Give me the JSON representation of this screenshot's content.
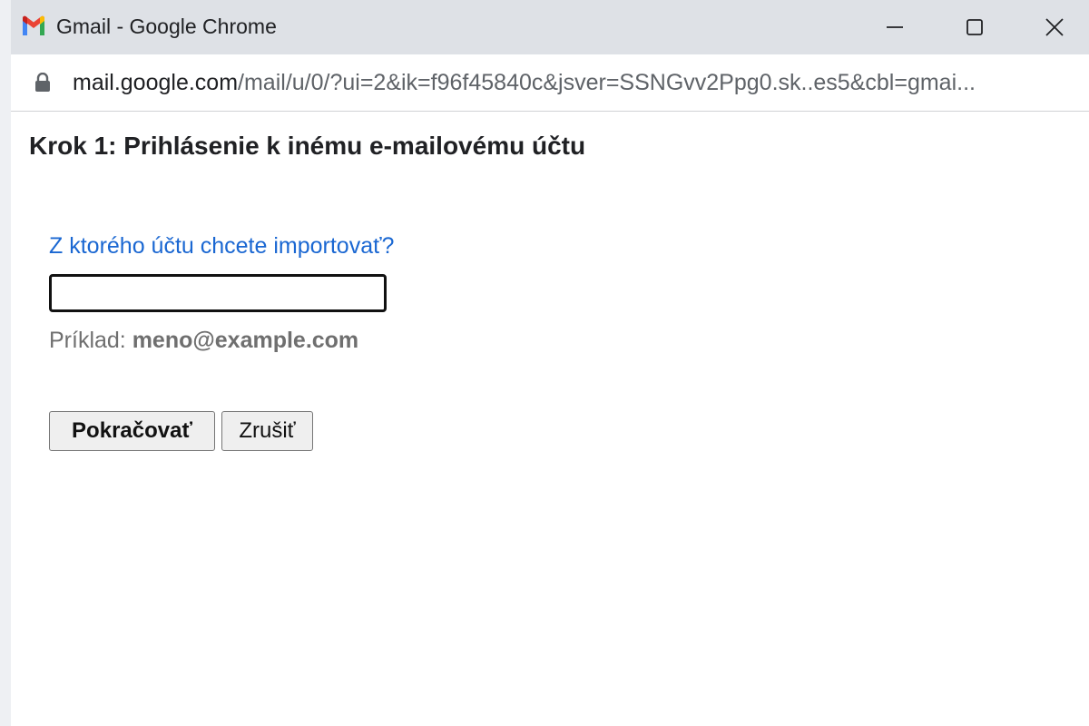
{
  "window": {
    "title": "Gmail - Google Chrome",
    "app_icon": "gmail-icon"
  },
  "addressbar": {
    "host": "mail.google.com",
    "path": "/mail/u/0/?ui=2&ik=f96f45840c&jsver=SSNGvv2Ppg0.sk..es5&cbl=gmai..."
  },
  "page": {
    "heading": "Krok 1: Prihlásenie k inému e-mailovému účtu",
    "question": "Z ktorého účtu chcete importovať?",
    "email_value": "",
    "example_prefix": "Príklad: ",
    "example_value": "meno@example.com",
    "continue_label": "Pokračovať",
    "cancel_label": "Zrušiť"
  },
  "colors": {
    "link_blue": "#1a67d2",
    "titlebar": "#dee1e6",
    "gmail_red": "#ea4335",
    "gmail_blue": "#4285f4",
    "gmail_green": "#34a853",
    "gmail_yellow": "#fbbc04"
  }
}
